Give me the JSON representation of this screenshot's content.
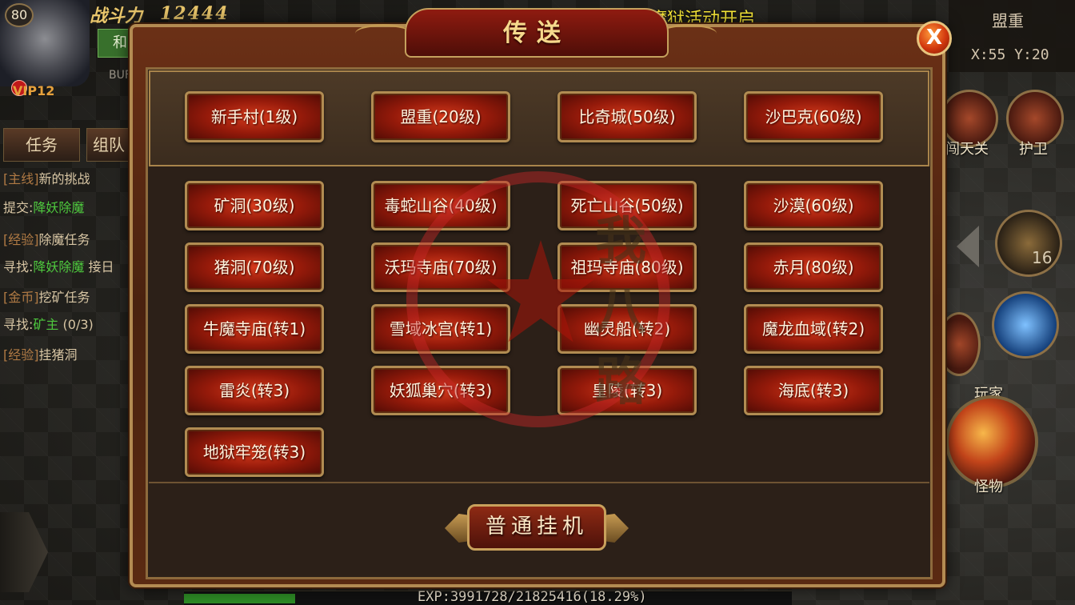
{
  "hud": {
    "level": "80",
    "power_label": "战斗力",
    "power_value": "12444",
    "mode": "和",
    "vip": "VIP12",
    "buff": "BUF"
  },
  "task_tabs": [
    "任务",
    "组队"
  ],
  "quests": [
    {
      "tag": "[主线]",
      "text": "新的挑战"
    },
    {
      "tag": "提交:",
      "hl": "降妖除魔"
    },
    {
      "tag": "[经验]",
      "text": "除魔任务"
    },
    {
      "tag": "寻找:",
      "hl": "降妖除魔",
      "text": "接日"
    },
    {
      "tag": "[金币]",
      "text": "挖矿任务"
    },
    {
      "tag": "寻找:",
      "hl": "矿主",
      "text": "(0/3)"
    },
    {
      "tag": "[经验]",
      "text": "挂猪洞"
    }
  ],
  "banner": "神威魔狱活动开启",
  "map": {
    "name": "盟重",
    "coord": "X:55 Y:20"
  },
  "side": {
    "tianguan": "闯天关",
    "guard": "护卫",
    "bag_count": "16",
    "player": "玩家",
    "monster": "怪物"
  },
  "exp": {
    "text": "EXP:3991728/21825416(18.29%)",
    "percent": 18.29
  },
  "dialog": {
    "title": "传送",
    "close": "X",
    "hangup": "普通挂机",
    "main_cities": [
      "新手村(1级)",
      "盟重(20级)",
      "比奇城(50级)",
      "沙巴克(60级)"
    ],
    "destinations": [
      "矿洞(30级)",
      "毒蛇山谷(40级)",
      "死亡山谷(50级)",
      "沙漠(60级)",
      "猪洞(70级)",
      "沃玛寺庙(70级)",
      "祖玛寺庙(80级)",
      "赤月(80级)",
      "牛魔寺庙(转1)",
      "雪域冰宫(转1)",
      "幽灵船(转2)",
      "魔龙血域(转2)",
      "雷炎(转3)",
      "妖狐巢穴(转3)",
      "皇陵(转3)",
      "海底(转3)",
      "地狱牢笼(转3)"
    ]
  },
  "watermark": "我八路"
}
